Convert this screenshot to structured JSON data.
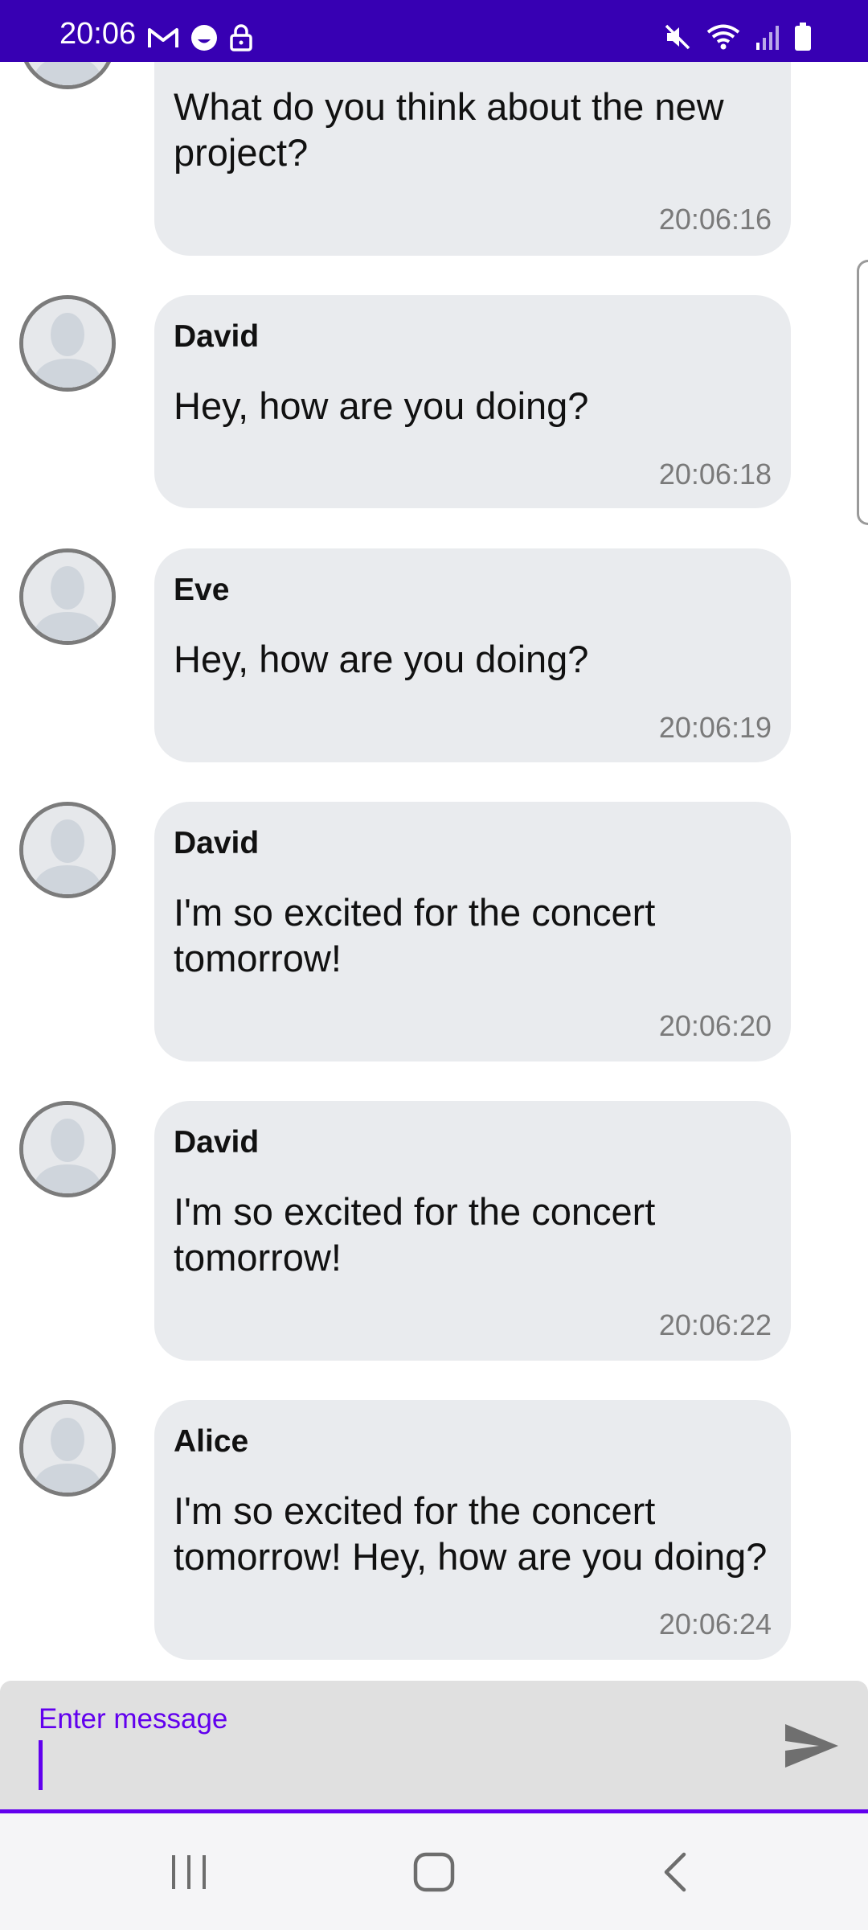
{
  "status_bar": {
    "time": "20:06",
    "left_icons": [
      "gmail-icon",
      "face-icon",
      "lock-icon"
    ],
    "right_icons": [
      "mute-icon",
      "wifi-icon",
      "signal-icon",
      "battery-icon"
    ]
  },
  "messages": [
    {
      "sender": "",
      "text": "What do you think about the new project?",
      "time": "20:06:16"
    },
    {
      "sender": "David",
      "text": "Hey, how are you doing?",
      "time": "20:06:18"
    },
    {
      "sender": "Eve",
      "text": "Hey, how are you doing?",
      "time": "20:06:19"
    },
    {
      "sender": "David",
      "text": "I'm so excited for the concert tomorrow!",
      "time": "20:06:20"
    },
    {
      "sender": "David",
      "text": "I'm so excited for the concert tomorrow!",
      "time": "20:06:22"
    },
    {
      "sender": "Alice",
      "text": "I'm so excited for the concert tomorrow! Hey, how are you doing?",
      "time": "20:06:24"
    }
  ],
  "composer": {
    "label": "Enter message",
    "value": "",
    "send_icon": "send-icon"
  },
  "nav_bar": {
    "buttons": [
      "recent-apps-icon",
      "home-icon",
      "back-icon"
    ]
  },
  "colors": {
    "status_bar": "#3700b3",
    "accent": "#6200ee",
    "bubble": "#e9ebee",
    "avatar_border": "#7b7b7b"
  }
}
